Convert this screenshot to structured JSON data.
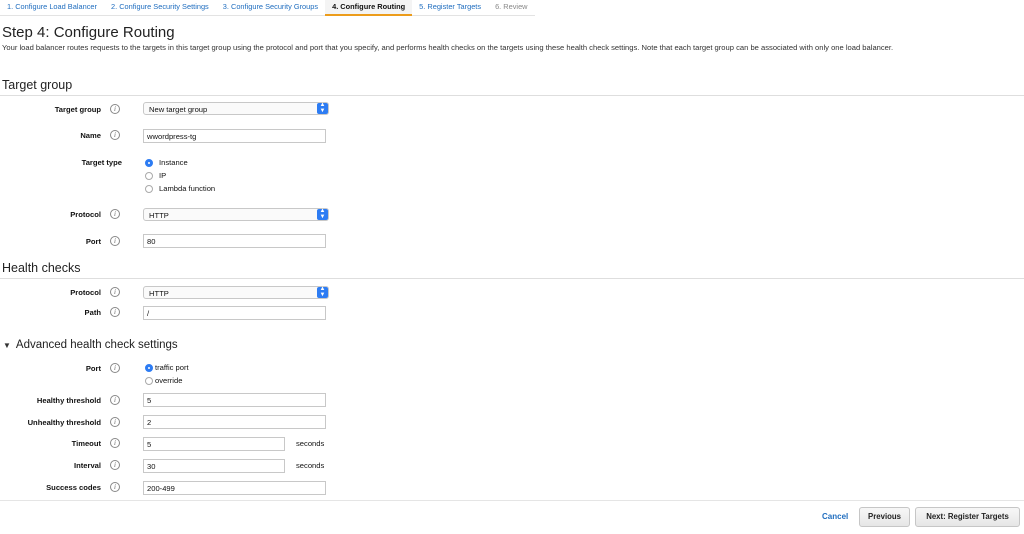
{
  "wizard": {
    "steps": [
      "1. Configure Load Balancer",
      "2. Configure Security Settings",
      "3. Configure Security Groups",
      "4. Configure Routing",
      "5. Register Targets",
      "6. Review"
    ],
    "active_step": "4. Configure Routing"
  },
  "page": {
    "title": "Step 4: Configure Routing",
    "description": "Your load balancer routes requests to the targets in this target group using the protocol and port that you specify, and performs health checks on the targets using these health check settings. Note that each target group can be associated with only one load balancer."
  },
  "target_group": {
    "section_title": "Target group",
    "target_group_label": "Target group",
    "target_group_value": "New target group",
    "name_label": "Name",
    "name_value": "wwordpress-tg",
    "target_type_label": "Target type",
    "target_type_options": [
      "Instance",
      "IP",
      "Lambda function"
    ],
    "target_type_selected": "Instance",
    "protocol_label": "Protocol",
    "protocol_value": "HTTP",
    "port_label": "Port",
    "port_value": "80"
  },
  "health_checks": {
    "section_title": "Health checks",
    "protocol_label": "Protocol",
    "protocol_value": "HTTP",
    "path_label": "Path",
    "path_value": "/"
  },
  "advanced": {
    "toggle_label": "Advanced health check settings",
    "port_label": "Port",
    "port_options": [
      "traffic port",
      "override"
    ],
    "port_selected": "traffic port",
    "healthy_threshold_label": "Healthy threshold",
    "healthy_threshold_value": "5",
    "unhealthy_threshold_label": "Unhealthy threshold",
    "unhealthy_threshold_value": "2",
    "timeout_label": "Timeout",
    "timeout_value": "5",
    "timeout_unit": "seconds",
    "interval_label": "Interval",
    "interval_value": "30",
    "interval_unit": "seconds",
    "success_codes_label": "Success codes",
    "success_codes_value": "200-499"
  },
  "footer": {
    "cancel": "Cancel",
    "previous": "Previous",
    "next": "Next: Register Targets"
  },
  "info_glyph": "i",
  "colors": {
    "link_blue": "#1f6dbf",
    "active_tab_underline": "#ec9c1b",
    "control_blue": "#2d7cf3"
  }
}
